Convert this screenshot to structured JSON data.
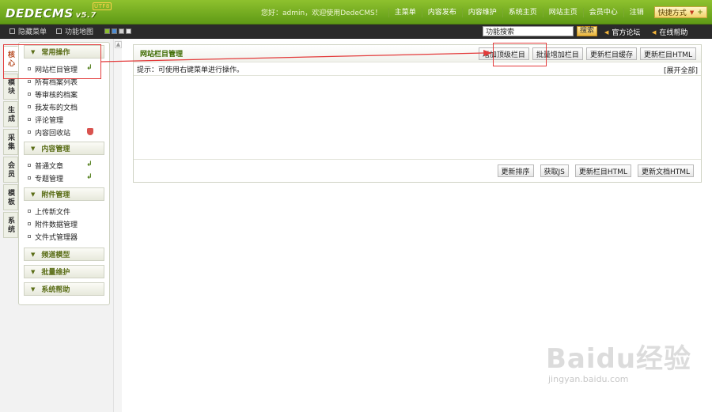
{
  "header": {
    "logo_text": "DEDECMS",
    "logo_version": "v5.7",
    "logo_badge": "UTF8",
    "greeting": "您好：admin，欢迎使用DedeCMS！",
    "nav": [
      "主菜单",
      "内容发布",
      "内容维护",
      "系统主页",
      "网站主页",
      "会员中心",
      "注销"
    ],
    "quick_label": "快捷方式"
  },
  "subbar": {
    "hide_menu": "隐藏菜单",
    "site_map": "功能地图",
    "search_value": "功能搜索",
    "search_button": "搜索",
    "forum_link": "官方论坛",
    "help_link": "在线帮助"
  },
  "side_tabs": [
    "核心",
    "模块",
    "生成",
    "采集",
    "会员",
    "模板",
    "系统"
  ],
  "menu": {
    "section1": {
      "title": "常用操作",
      "items": [
        "网站栏目管理",
        "所有档案列表",
        "等审核的档案",
        "我发布的文档",
        "评论管理",
        "内容回收站"
      ]
    },
    "section2": {
      "title": "内容管理",
      "items": [
        "普通文章",
        "专题管理"
      ]
    },
    "section3": {
      "title": "附件管理",
      "items": [
        "上传新文件",
        "附件数据管理",
        "文件式管理器"
      ]
    },
    "section4_title": "频道模型",
    "section5_title": "批量维护",
    "section6_title": "系统帮助"
  },
  "panel": {
    "title": "网站栏目管理",
    "buttons": [
      "增加顶级栏目",
      "批量增加栏目",
      "更新栏目缓存",
      "更新栏目HTML"
    ],
    "hint": "提示：可使用右键菜单进行操作。",
    "expand_all": "[展开全部]",
    "footer_buttons": [
      "更新排序",
      "获取JS",
      "更新栏目HTML",
      "更新文档HTML"
    ]
  },
  "watermark": {
    "main": "Baidu经验",
    "sub": "jingyan.baidu.com"
  },
  "colors": {
    "topbar": "#6fa81c",
    "subbar": "#2a2a2a",
    "highlight": "#e33b3b",
    "menu_head_text": "#5a6d16"
  }
}
